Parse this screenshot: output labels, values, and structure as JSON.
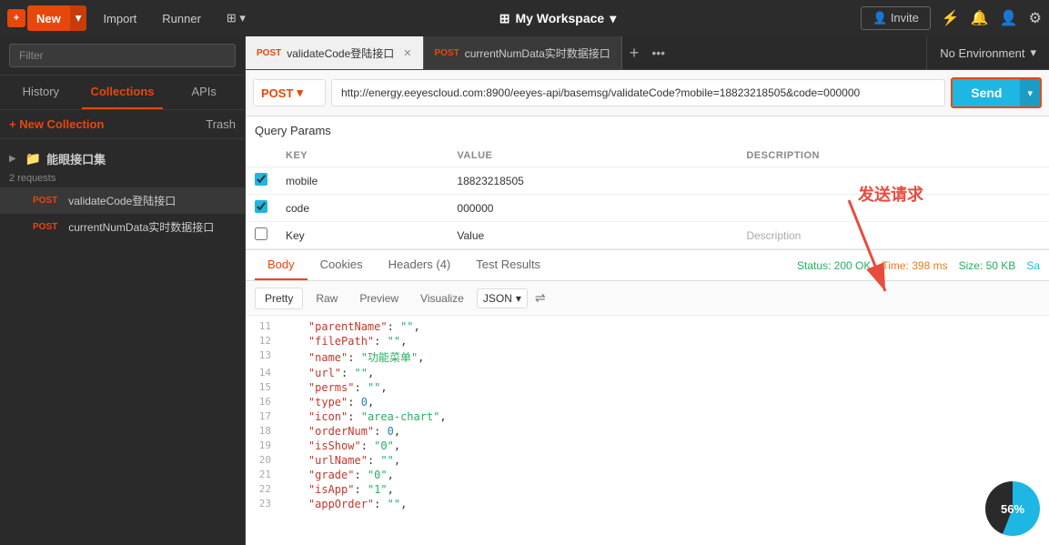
{
  "topbar": {
    "new_label": "New",
    "import_label": "Import",
    "runner_label": "Runner",
    "workspace_label": "My Workspace",
    "invite_label": "Invite"
  },
  "sidebar": {
    "search_placeholder": "Filter",
    "tabs": [
      {
        "id": "history",
        "label": "History"
      },
      {
        "id": "collections",
        "label": "Collections"
      },
      {
        "id": "apis",
        "label": "APIs"
      }
    ],
    "new_collection_label": "+ New Collection",
    "trash_label": "Trash",
    "collection": {
      "name": "能眼接口集",
      "count": "2 requests",
      "requests": [
        {
          "method": "POST",
          "name": "validateCode登陆接口",
          "active": true
        },
        {
          "method": "POST",
          "name": "currentNumData实时数据接口",
          "active": false
        }
      ]
    }
  },
  "tabs": [
    {
      "method": "POST",
      "label": "validateCode登陆接口",
      "active": true,
      "closable": true
    },
    {
      "method": "POST",
      "label": "currentNumData实时数据接口",
      "active": false,
      "closable": false
    }
  ],
  "no_environment": "No Environment",
  "request": {
    "method": "POST",
    "url": "http://energy.eeyescloud.com:8900/eeyes-api/basemsg/validateCode?mobile=18823218505&code=000000",
    "send_label": "Send"
  },
  "query_params": {
    "title": "Query Params",
    "columns": [
      "KEY",
      "VALUE",
      "DESCRIPTION"
    ],
    "rows": [
      {
        "checked": true,
        "key": "mobile",
        "value": "18823218505",
        "description": ""
      },
      {
        "checked": true,
        "key": "code",
        "value": "000000",
        "description": ""
      },
      {
        "checked": false,
        "key": "",
        "value": "",
        "description": ""
      }
    ],
    "key_placeholder": "Key",
    "value_placeholder": "Value",
    "description_placeholder": "Description"
  },
  "body_tabs": [
    {
      "id": "body",
      "label": "Body"
    },
    {
      "id": "cookies",
      "label": "Cookies"
    },
    {
      "id": "headers",
      "label": "Headers (4)"
    },
    {
      "id": "test_results",
      "label": "Test Results"
    }
  ],
  "status": {
    "status_text": "Status: 200 OK",
    "time_text": "Time: 398 ms",
    "size_text": "Size: 50 KB",
    "save_text": "Sa"
  },
  "code_toolbar": {
    "tabs": [
      "Pretty",
      "Raw",
      "Preview",
      "Visualize"
    ],
    "format": "JSON",
    "active_tab": "Pretty"
  },
  "code_lines": [
    {
      "num": "11",
      "code": "    \"parentName\": \"\","
    },
    {
      "num": "12",
      "code": "    \"filePath\": \"\","
    },
    {
      "num": "13",
      "code": "    \"name\": \"功能菜单\","
    },
    {
      "num": "14",
      "code": "    \"url\": \"\","
    },
    {
      "num": "15",
      "code": "    \"perms\": \"\","
    },
    {
      "num": "16",
      "code": "    \"type\": 0,"
    },
    {
      "num": "17",
      "code": "    \"icon\": \"area-chart\","
    },
    {
      "num": "18",
      "code": "    \"orderNum\": 0,"
    },
    {
      "num": "19",
      "code": "    \"isShow\": \"0\","
    },
    {
      "num": "20",
      "code": "    \"urlName\": \"\","
    },
    {
      "num": "21",
      "code": "    \"grade\": \"0\","
    },
    {
      "num": "22",
      "code": "    \"isApp\": \"1\","
    },
    {
      "num": "23",
      "code": "    \"appOrder\": \"\","
    }
  ],
  "annotation": {
    "text": "发送请求"
  },
  "widget": {
    "percent": "56%"
  }
}
